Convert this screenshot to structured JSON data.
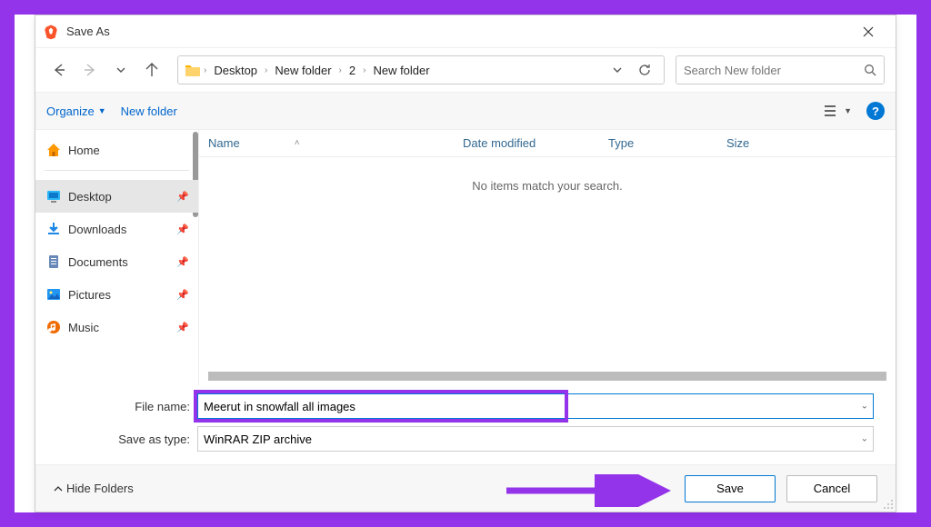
{
  "title": "Save As",
  "breadcrumbs": [
    "Desktop",
    "New folder",
    "2",
    "New folder"
  ],
  "search_placeholder": "Search New folder",
  "toolbar": {
    "organize": "Organize",
    "new_folder": "New folder"
  },
  "sidebar": {
    "home": "Home",
    "items": [
      {
        "label": "Desktop"
      },
      {
        "label": "Downloads"
      },
      {
        "label": "Documents"
      },
      {
        "label": "Pictures"
      },
      {
        "label": "Music"
      }
    ]
  },
  "columns": {
    "name": "Name",
    "date": "Date modified",
    "type": "Type",
    "size": "Size"
  },
  "empty_message": "No items match your search.",
  "file_name_label": "File name:",
  "file_name_value": "Meerut in snowfall all images",
  "save_type_label": "Save as type:",
  "save_type_value": "WinRAR ZIP archive",
  "hide_folders": "Hide Folders",
  "save_btn": "Save",
  "cancel_btn": "Cancel"
}
